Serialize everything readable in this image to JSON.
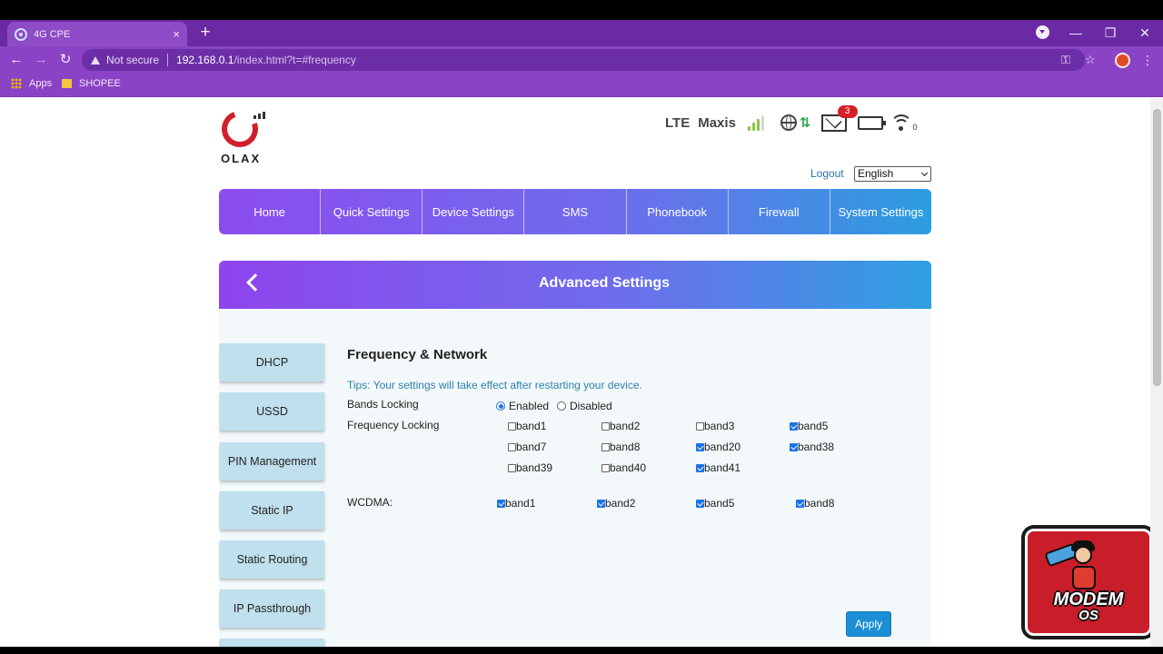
{
  "browser": {
    "tab_title": "4G CPE",
    "tab_close": "×",
    "new_tab": "+",
    "window_controls": {
      "minimize": "—",
      "maximize": "❐",
      "close": "✕"
    },
    "back": "←",
    "forward": "→",
    "reload": "↻",
    "security_label": "Not secure",
    "url_host": "192.168.0.1",
    "url_path": "/index.html?t=#frequency",
    "key_icon": "⚿",
    "star_icon": "☆",
    "menu": "⋮",
    "bookmarks": [
      {
        "label": "Apps",
        "icon": "apps-grid-icon"
      },
      {
        "label": "SHOPEE",
        "icon": "folder-icon"
      }
    ]
  },
  "header": {
    "brand": "OLAX",
    "network_type": "LTE",
    "carrier": "Maxis",
    "arrows": "⇅",
    "unread_messages": "3",
    "wifi_clients": "0",
    "logout": "Logout",
    "language": "English",
    "signal_color": "#8ac640",
    "battery_color": "#22b24c",
    "badge_color": "#d61f26"
  },
  "nav": {
    "items": [
      "Home",
      "Quick Settings",
      "Device Settings",
      "SMS",
      "Phonebook",
      "Firewall",
      "System Settings"
    ]
  },
  "advanced": {
    "title": "Advanced Settings",
    "side_menu": [
      "DHCP",
      "USSD",
      "PIN Management",
      "Static IP",
      "Static Routing",
      "IP Passthrough"
    ]
  },
  "frequency": {
    "title": "Frequency & Network",
    "tips": "Tips: Your settings will take effect after restarting your device.",
    "bands_locking_label": "Bands Locking",
    "bands_locking_options": [
      "Enabled",
      "Disabled"
    ],
    "bands_locking_selected": "Enabled",
    "frequency_locking_label": "Frequency Locking",
    "lte_bands": [
      {
        "label": "band1",
        "checked": false
      },
      {
        "label": "band2",
        "checked": false
      },
      {
        "label": "band3",
        "checked": false
      },
      {
        "label": "band5",
        "checked": true
      },
      {
        "label": "band7",
        "checked": false
      },
      {
        "label": "band8",
        "checked": false
      },
      {
        "label": "band20",
        "checked": true
      },
      {
        "label": "band38",
        "checked": true
      },
      {
        "label": "band39",
        "checked": false
      },
      {
        "label": "band40",
        "checked": false
      },
      {
        "label": "band41",
        "checked": true
      }
    ],
    "wcdma_label": "WCDMA:",
    "wcdma_bands": [
      {
        "label": "band1",
        "checked": true
      },
      {
        "label": "band2",
        "checked": true
      },
      {
        "label": "band5",
        "checked": true
      },
      {
        "label": "band8",
        "checked": true
      }
    ],
    "apply_label": "Apply"
  },
  "watermark": {
    "title": "MODEM",
    "subtitle": "OS"
  }
}
